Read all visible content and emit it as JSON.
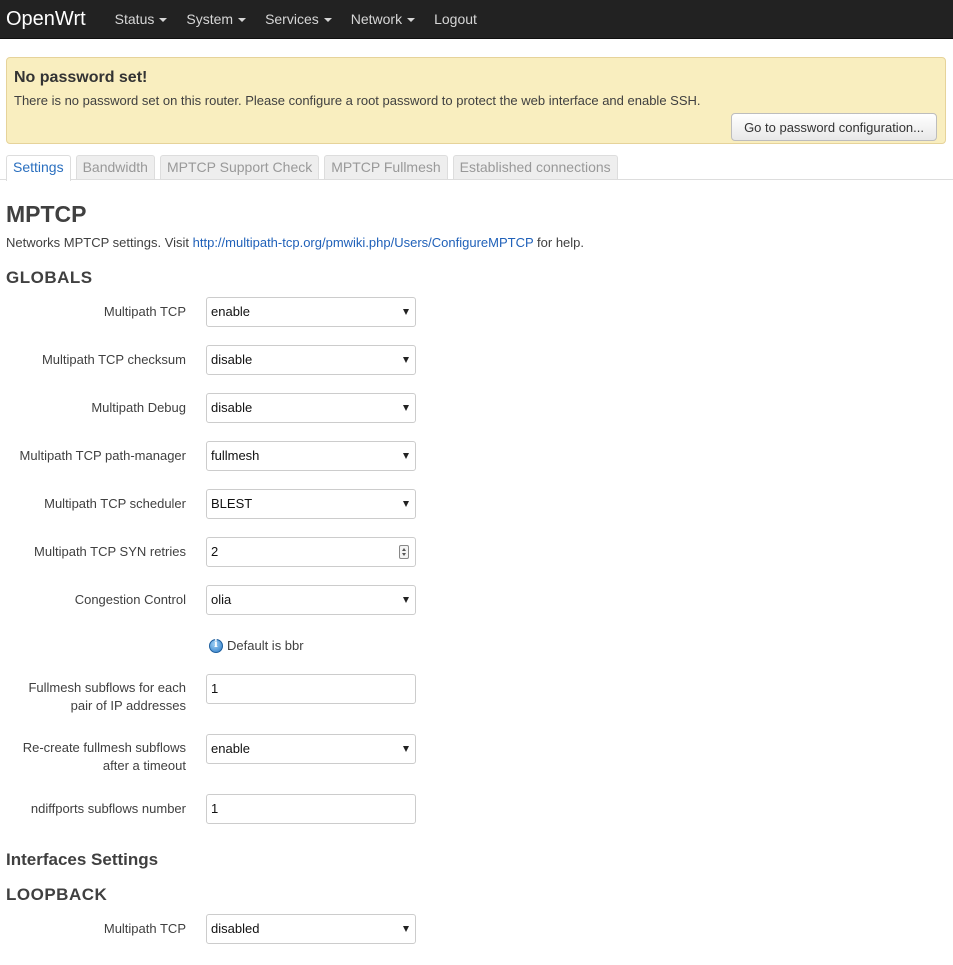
{
  "navbar": {
    "brand": "OpenWrt",
    "items": [
      {
        "label": "Status"
      },
      {
        "label": "System"
      },
      {
        "label": "Services"
      },
      {
        "label": "Network"
      },
      {
        "label": "Logout"
      }
    ]
  },
  "alert": {
    "title": "No password set!",
    "text": "There is no password set on this router. Please configure a root password to protect the web interface and enable SSH.",
    "button_label": "Go to password configuration..."
  },
  "tabs": [
    {
      "label": "Settings",
      "active": true
    },
    {
      "label": "Bandwidth"
    },
    {
      "label": "MPTCP Support Check"
    },
    {
      "label": "MPTCP Fullmesh"
    },
    {
      "label": "Established connections"
    }
  ],
  "page": {
    "title": "MPTCP",
    "desc_prefix": "Networks MPTCP settings. Visit ",
    "desc_link": "http://multipath-tcp.org/pmwiki.php/Users/ConfigureMPTCP",
    "desc_suffix": " for help."
  },
  "globals": {
    "title": "GLOBALS",
    "fields": {
      "multipath_tcp": {
        "label": "Multipath TCP",
        "value": "enable"
      },
      "checksum": {
        "label": "Multipath TCP checksum",
        "value": "disable"
      },
      "debug": {
        "label": "Multipath Debug",
        "value": "disable"
      },
      "path_manager": {
        "label": "Multipath TCP path-manager",
        "value": "fullmesh"
      },
      "scheduler": {
        "label": "Multipath TCP scheduler",
        "value": "BLEST"
      },
      "syn_retries": {
        "label": "Multipath TCP SYN retries",
        "value": "2"
      },
      "congestion": {
        "label": "Congestion Control",
        "value": "olia",
        "hint": "Default is bbr"
      },
      "fullmesh_subflows": {
        "label_line1": "Fullmesh subflows for each",
        "label_line2": "pair of IP addresses",
        "value": "1"
      },
      "recreate": {
        "label_line1": "Re-create fullmesh subflows",
        "label_line2": "after a timeout",
        "value": "enable"
      },
      "ndiffports": {
        "label": "ndiffports subflows number",
        "value": "1"
      }
    }
  },
  "interfaces": {
    "title": "Interfaces Settings",
    "loopback": {
      "title": "LOOPBACK",
      "multipath_tcp": {
        "label": "Multipath TCP",
        "value": "disabled"
      }
    }
  }
}
